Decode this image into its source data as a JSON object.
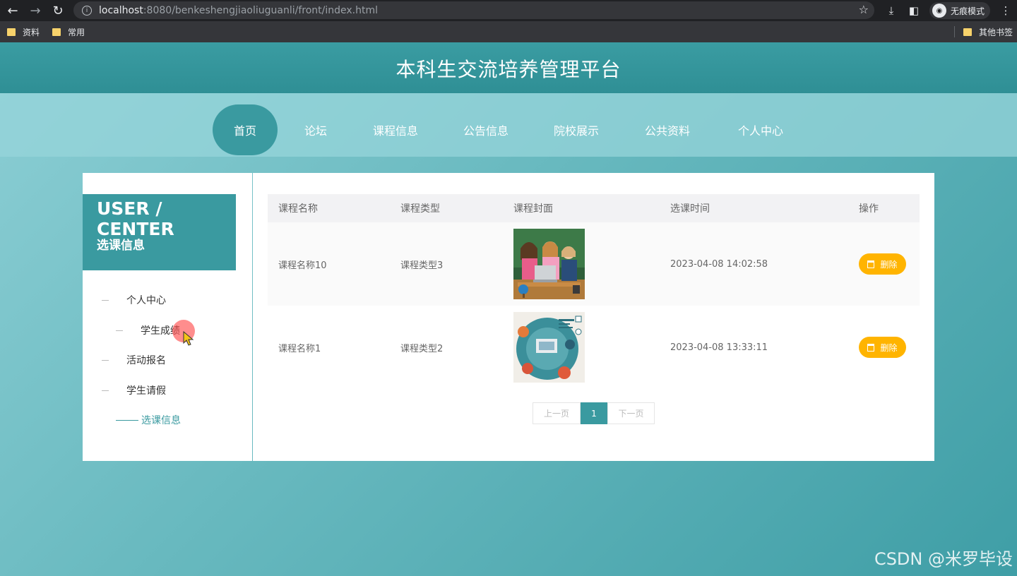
{
  "browser": {
    "url_host": "localhost",
    "url_rest": ":8080/benkeshengjiaoliuguanli/front/index.html",
    "incognito_label": "无痕模式",
    "bookmarks": [
      "资料",
      "常用"
    ],
    "other_bookmarks": "其他书签"
  },
  "site": {
    "title": "本科生交流培养管理平台"
  },
  "nav": {
    "items": [
      "首页",
      "论坛",
      "课程信息",
      "公告信息",
      "院校展示",
      "公共资料",
      "个人中心"
    ]
  },
  "sidebar": {
    "heading": "USER / CENTER",
    "subheading": "选课信息",
    "items": [
      "个人中心",
      "学生成绩",
      "活动报名",
      "学生请假",
      "选课信息"
    ]
  },
  "table": {
    "headers": [
      "课程名称",
      "课程类型",
      "课程封面",
      "选课时间",
      "操作"
    ],
    "rows": [
      {
        "name": "课程名称10",
        "type": "课程类型3",
        "time": "2023-04-08 14:02:58",
        "action": "删除"
      },
      {
        "name": "课程名称1",
        "type": "课程类型2",
        "time": "2023-04-08 13:33:11",
        "action": "删除"
      }
    ]
  },
  "pager": {
    "prev": "上一页",
    "current": "1",
    "next": "下一页"
  },
  "watermark": "CSDN @米罗毕设",
  "colors": {
    "primary": "#3a9aa0",
    "delete": "#ffb400"
  }
}
